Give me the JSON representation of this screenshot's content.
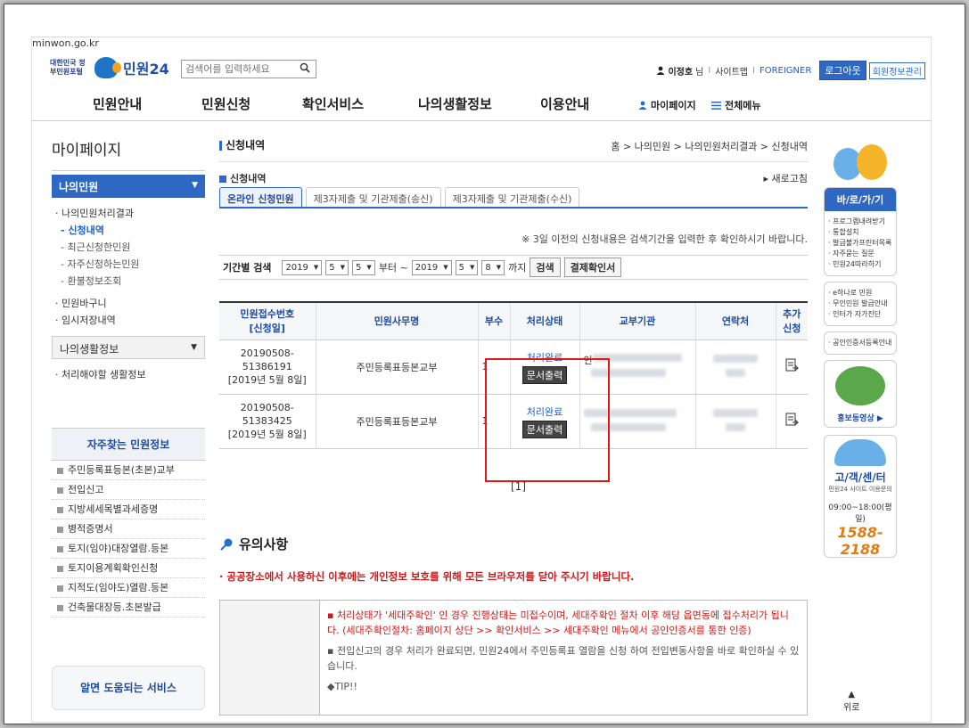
{
  "header": {
    "gov_label": "대한민국 정부민원포털",
    "brand": "민원24",
    "brand_sub": "minwon.go.kr",
    "search_placeholder": "검색어를 입력하세요",
    "user_name": "이정호",
    "user_suffix": "님",
    "sitemap": "사이트맵",
    "foreigner": "FOREIGNER",
    "logout": "로그아웃",
    "member": "회원정보관리"
  },
  "gnb": {
    "items": [
      "민원안내",
      "민원신청",
      "확인서비스",
      "나의생활정보",
      "이용안내"
    ],
    "mypage": "마이페이지",
    "allmenu": "전체메뉴"
  },
  "lnb": {
    "title": "마이페이지",
    "section1": "나의민원",
    "sub1": "나의민원처리결과",
    "sub1_children": [
      "신청내역",
      "최근신청한민원",
      "자주신청하는민원",
      "환불정보조회"
    ],
    "sub2": "민원바구니",
    "sub3": "임시저장내역",
    "section2": "나의생활정보",
    "section2_item": "처리해야할 생활정보",
    "freq_title": "자주찾는 민원정보",
    "freq_items": [
      "주민등록표등본(초본)교부",
      "전입신고",
      "지방세세목별과세증명",
      "병적증명서",
      "토지(임야)대장열람.등본",
      "토지이용계획확인신청",
      "지적도(임야도)열람.등본",
      "건축물대장등.초본발급"
    ],
    "help": "알면 도움되는 서비스"
  },
  "content": {
    "title": "신청내역",
    "breadcrumb": "홈  >  나의민원  >  나의민원처리결과  >  신청내역",
    "subtitle": "신청내역",
    "refresh": "▸ 새로고침",
    "tabs": [
      "온라인 신청민원",
      "제3자제출 및 기관제출(송신)",
      "제3자제출 및 기관제출(수신)"
    ],
    "notice": "※ 3일 이전의 신청내용은 검색기간을 입력한 후 확인하시기 바랍니다.",
    "filter_label": "기간별 검색",
    "from": {
      "year": "2019",
      "month": "5",
      "day": "5"
    },
    "from_text": "부터 ~",
    "to": {
      "year": "2019",
      "month": "5",
      "day": "8"
    },
    "to_text": "까지",
    "search_btn": "검색",
    "pay_btn": "결제확인서",
    "columns": [
      "민원접수번호\n[신청일]",
      "민원사무명",
      "부수",
      "처리상태",
      "교부기관",
      "연락처",
      "추가신청"
    ],
    "col_no_l1": "민원접수번호",
    "col_no_l2": "[신청일]",
    "col_add_l1": "추가",
    "col_add_l2": "신청",
    "rows": [
      {
        "no1": "20190508-",
        "no2": "51386191",
        "date": "[2019년 5월 8일]",
        "name": "주민등록표등본교부",
        "count": "1",
        "status": "처리완료",
        "print": "문서출력",
        "org_prefix": "인"
      },
      {
        "no1": "20190508-",
        "no2": "51383425",
        "date": "[2019년 5월 8일]",
        "name": "주민등록표등본교부",
        "count": "1",
        "status": "처리완료",
        "print": "문서출력",
        "org_prefix": ""
      }
    ],
    "pager": "[1]"
  },
  "caution": {
    "title": "유의사항",
    "lead": "· 공공장소에서 사용하신 이후에는 개인정보 보호를 위해 모든 브라우저를 닫아 주시기 바랍니다.",
    "p1": "처리상태가 '세대주확인' 인 경우 진행상태는 미접수이며, 세대주확인 절차 이후 해당 읍면동에 접수처리가 됩니다. (세대주확인절차: 홈페이지 상단 >> 확인서비스 >> 세대주확인 메뉴에서 공인인증서를 통한 인증)",
    "p2": "전입신고의 경우 처리가 완료되면, 민원24에서 주민등록표 열람을 신청 하여 전입변동사항을 바로 확인하실 수 있습니다.",
    "tip": "◆TIP!!"
  },
  "quick": {
    "head": "바/로/가/기",
    "links": [
      "프로그램내려받기",
      "통합설치",
      "발급불가프린터목록",
      "자주묻는 질문",
      "민원24따라하기"
    ],
    "links2": [
      "e하나로 민원",
      "무인민원 발급안내",
      "인터가 자가진단"
    ],
    "cert": "공인인증서등록안내",
    "video": "홍보동영상",
    "cs_title": "고/객/센/터",
    "cs_sub": "민원24 사이트 이용문의",
    "cs_hours": "09:00~18:00(평일)",
    "cs_phone": "1588-2188",
    "top": "위로"
  }
}
